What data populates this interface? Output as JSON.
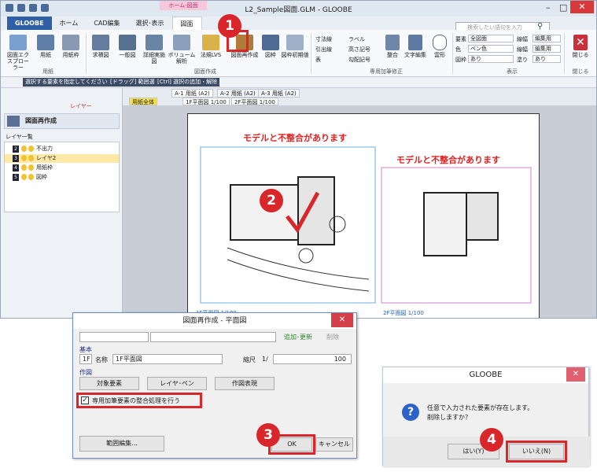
{
  "app": {
    "title": "L2_Sample図面.GLM - GLOOBE",
    "context_tab_group": "ホーム-図面"
  },
  "menu": {
    "items": [
      "GLOOBE",
      "ホーム",
      "CAD編集",
      "選択･表示",
      "図面"
    ]
  },
  "search": {
    "placeholder": "検索したい語句を入力"
  },
  "ribbon": {
    "group_yoshi": {
      "label": "用紙",
      "buttons": [
        "図面エクスプローラー",
        "用紙",
        "用紙枠"
      ]
    },
    "group_create": {
      "label": "図面作成",
      "buttons": [
        "求積図",
        "一般図",
        "詳細実施図",
        "ボリューム解析",
        "法規LVS",
        "図面再作成",
        "図枠",
        "図枠初期値"
      ]
    },
    "group_annot": {
      "label": "専用加筆修正",
      "items": [
        "寸法線",
        "ラベル",
        "引出線",
        "高さ記号",
        "表",
        "勾配記号",
        "整合",
        "文字編集",
        "雲形"
      ]
    },
    "group_display": {
      "label": "表示",
      "rows": [
        {
          "label": "要素",
          "value": "全図面",
          "sub_label": "線幅",
          "sub_value": "編集用"
        },
        {
          "label": "色",
          "value": "ペン色",
          "sub_label": "線幅",
          "sub_value": "編集用"
        },
        {
          "label": "図枠",
          "value": "あり",
          "sub_label": "塗り",
          "sub_value": "あり"
        }
      ]
    },
    "group_close": {
      "label": "閉じる",
      "button": "閉じる"
    }
  },
  "toolbar": {
    "hint_select": "選択する要素を指定してください",
    "hint_drag": "[ドラッグ] 範囲選択",
    "hint_ctrl": "[Ctrl] 選択の追加・解除"
  },
  "left_pane": {
    "layer_button": "レイヤー",
    "panel_title": "図面再作成",
    "list_title": "レイヤ一覧",
    "layers": [
      {
        "num": "2",
        "name": "不出力"
      },
      {
        "num": "3",
        "name": "レイヤ2"
      },
      {
        "num": "4",
        "name": "用紙枠"
      },
      {
        "num": "5",
        "name": "図枠"
      }
    ]
  },
  "doc_tabs": {
    "tabs": [
      "A-1 用紙 (A2)",
      "A-2 用紙 (A2)",
      "A-3 用紙 (A2)"
    ],
    "sub_tabs": [
      "用紙全体",
      "1F平面図 1/100",
      "2F平面図 1/100"
    ]
  },
  "drawing": {
    "warning_1": "モデルと不整合があります",
    "warning_2": "モデルと不整合があります",
    "caption_1": "1F平面図 1/100",
    "caption_2": "2F平面図 1/100"
  },
  "dialog_main": {
    "title": "図面再作成 - 平面図",
    "add_update": "追加･更新",
    "delete": "削除",
    "section_basic": "基本",
    "floor": "1F",
    "name_label": "名称",
    "name_value": "1F平面図",
    "scale_label": "縮尺",
    "scale_prefix": "1/",
    "scale_value": "100",
    "section_draw": "作図",
    "btn_target": "対象要素",
    "btn_layer_pen": "レイヤ･ペン",
    "btn_expression": "作図表現",
    "checkbox_label": "専用加筆要素の整合処理を行う",
    "btn_range": "範囲編集...",
    "ok": "OK",
    "cancel": "キャンセル"
  },
  "dialog_confirm": {
    "title": "GLOOBE",
    "message_1": "任意で入力された要素が存在します。",
    "message_2": "削除しますか？",
    "yes": "はい(Y)",
    "no": "いいえ(N)"
  },
  "steps": [
    "1",
    "2",
    "3",
    "4"
  ],
  "colors": {
    "accent_red": "#d8262a",
    "brand_blue": "#2f5fa7"
  }
}
